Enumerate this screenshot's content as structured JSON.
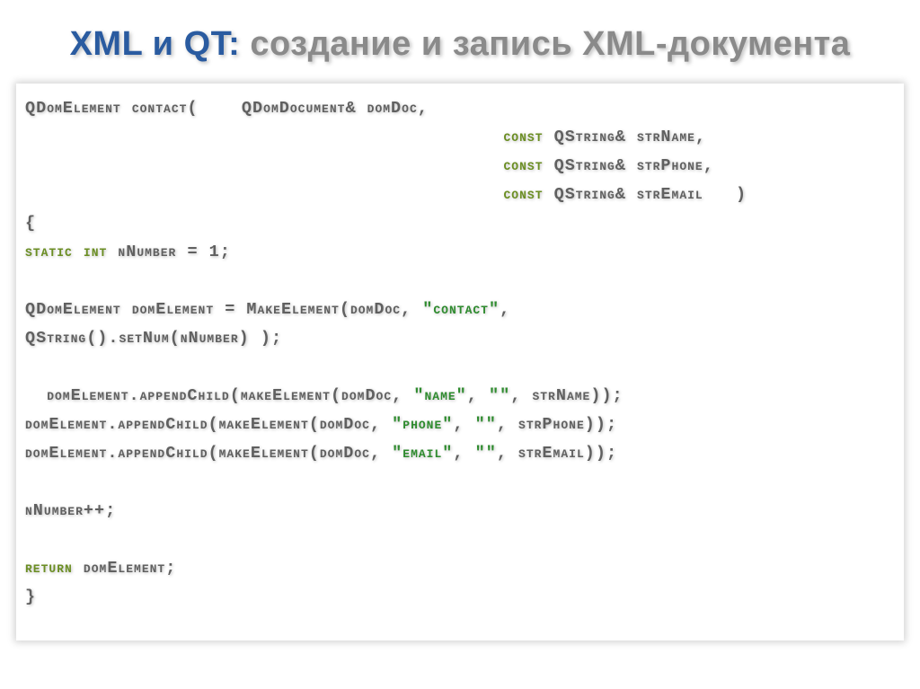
{
  "title": {
    "blue": "XML и QT:",
    "gray": " создание и запись XML-документа"
  },
  "code": {
    "l1a": "QDomElement contact(    QDomDocument& domDoc,",
    "l2a": "                                            ",
    "l2k": "const",
    "l2b": " QString& strName,",
    "l3a": "                                            ",
    "l3k": "const",
    "l3b": " QString& strPhone,",
    "l4a": "                                            ",
    "l4k": "const",
    "l4b": " QString& strEmail   )",
    "l5": "{",
    "l6k": "static int",
    "l6b": " nNumber = 1;",
    "l7": "",
    "l8a": "QDomElement domElement = MakeElement(domDoc, ",
    "l8s": "\"contact\"",
    "l8b": ",",
    "l9": "QString().setNum(nNumber) );",
    "l10": "",
    "l11a": "  domElement.appendChild(makeElement(domDoc, ",
    "l11s1": "\"name\"",
    "l11m": ", ",
    "l11s2": "\"\"",
    "l11b": ", strName));",
    "l12a": "domElement.appendChild(makeElement(domDoc, ",
    "l12s1": "\"phone\"",
    "l12m": ", ",
    "l12s2": "\"\"",
    "l12b": ", strPhone));",
    "l13a": "domElement.appendChild(makeElement(domDoc, ",
    "l13s1": "\"email\"",
    "l13m": ", ",
    "l13s2": "\"\"",
    "l13b": ", strEmail));",
    "l14": "",
    "l15": "nNumber++;",
    "l16": "",
    "l17k": "return",
    "l17b": " domElement;",
    "l18": "}"
  }
}
